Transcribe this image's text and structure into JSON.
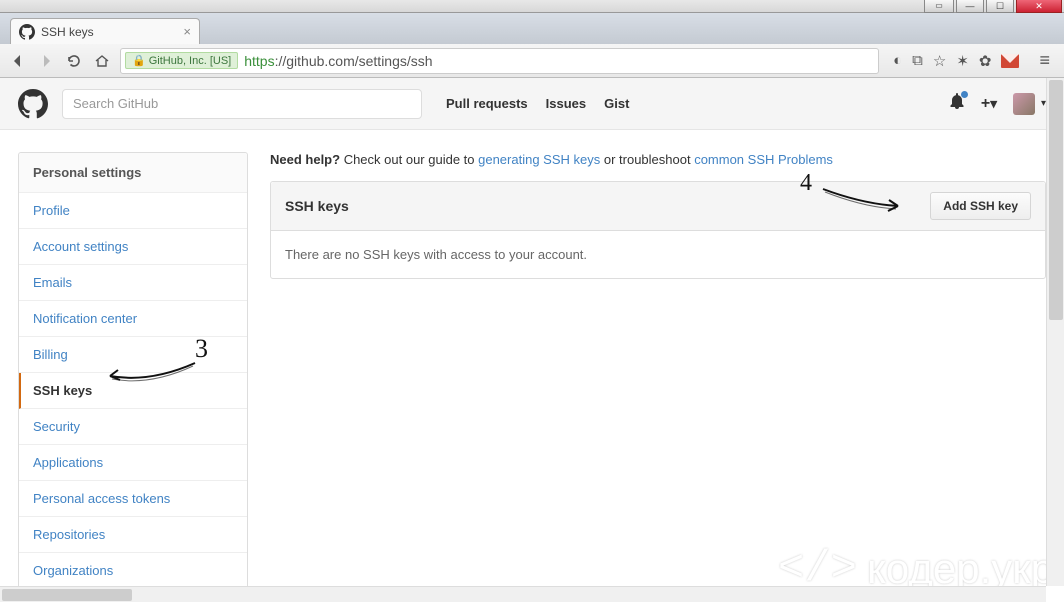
{
  "window": {
    "min": "—",
    "max": "☐",
    "close": "✕",
    "extra": "▭"
  },
  "tab": {
    "title": "SSH keys"
  },
  "toolbar": {
    "ssl_label": "GitHub, Inc. [US]",
    "url_proto": "https",
    "url_rest": "://github.com/settings/ssh"
  },
  "gh": {
    "search_placeholder": "Search GitHub",
    "nav": {
      "pulls": "Pull requests",
      "issues": "Issues",
      "gist": "Gist"
    },
    "plus": "+"
  },
  "sidebar": {
    "header": "Personal settings",
    "items": [
      "Profile",
      "Account settings",
      "Emails",
      "Notification center",
      "Billing",
      "SSH keys",
      "Security",
      "Applications",
      "Personal access tokens",
      "Repositories",
      "Organizations"
    ]
  },
  "help": {
    "prefix_bold": "Need help?",
    "prefix": " Check out our guide to ",
    "link1": "generating SSH keys",
    "mid": " or troubleshoot ",
    "link2": "common SSH Problems"
  },
  "panel": {
    "title": "SSH keys",
    "add_btn": "Add SSH key",
    "empty": "There are no SSH keys with access to your account."
  },
  "annotations": {
    "n3": "3",
    "n4": "4"
  },
  "watermark": {
    "icon": "</>",
    "text": "кодер.укр"
  }
}
